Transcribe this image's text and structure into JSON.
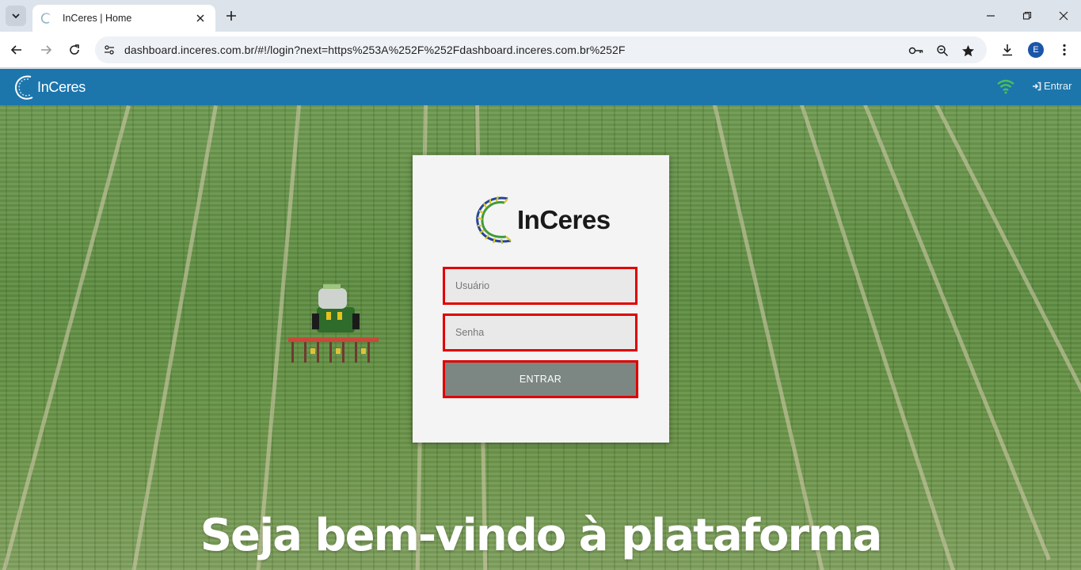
{
  "browser": {
    "tab_title": "InCeres | Home",
    "url": "dashboard.inceres.com.br/#!/login?next=https%253A%252F%252Fdashboard.inceres.com.br%252F",
    "profile_initial": "E"
  },
  "app": {
    "brand": "InCeres",
    "login_link": "Entrar",
    "accent_color": "#1c76ac"
  },
  "login": {
    "logo_text": "InCeres",
    "username_placeholder": "Usuário",
    "password_placeholder": "Senha",
    "submit_label": "ENTRAR"
  },
  "hero": {
    "welcome_text": "Seja bem-vindo à plataforma"
  },
  "icons": [
    "tab-search-icon",
    "favicon-icon",
    "close-icon",
    "plus-icon",
    "minimize-icon",
    "restore-icon",
    "back-icon",
    "forward-icon",
    "reload-icon",
    "site-info-icon",
    "key-icon",
    "zoom-icon",
    "star-icon",
    "download-icon",
    "menu-icon",
    "wifi-icon",
    "sign-in-icon"
  ]
}
